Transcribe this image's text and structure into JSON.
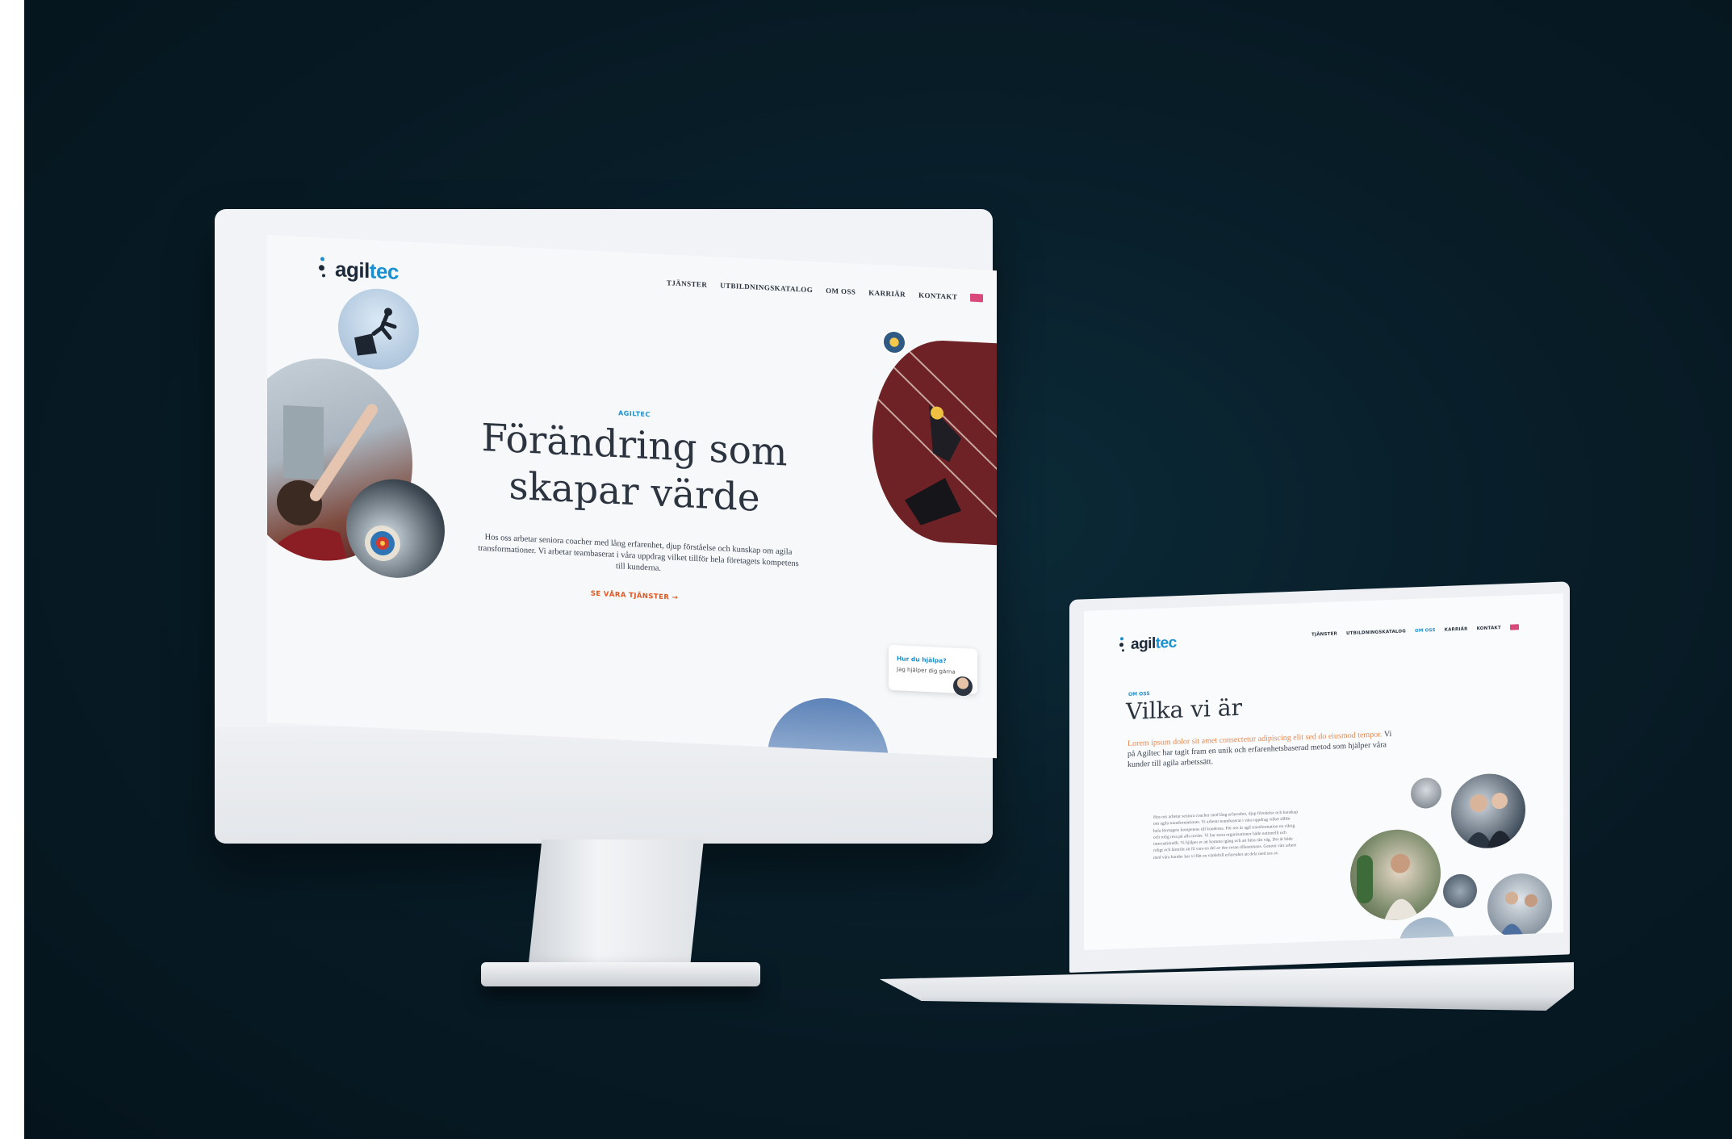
{
  "desktop_site": {
    "logo": {
      "text_dark": "agil",
      "text_accent": "tec"
    },
    "nav": [
      "TJÄNSTER",
      "UTBILDNINGSKATALOG",
      "OM OSS",
      "KARRIÄR",
      "KONTAKT"
    ],
    "hero": {
      "eyebrow": "AGILTEC",
      "title_line1": "Förändring som",
      "title_line2": "skapar värde",
      "body": "Hos oss arbetar seniora coacher med lång erfarenhet, djup förståelse och kunskap om agila transformationer. Vi arbetar teambaserat i våra uppdrag vilket tillför hela företagets kompetens till kunderna.",
      "cta": "SE VÅRA TJÄNSTER →"
    },
    "chat": {
      "title": "Hur du hjälpa?",
      "subtitle": "Jag hjälper dig gärna"
    }
  },
  "laptop_site": {
    "logo": {
      "text_dark": "agil",
      "text_accent": "tec"
    },
    "nav": [
      "TJÄNSTER",
      "UTBILDNINGSKATALOG",
      "OM OSS",
      "KARRIÄR",
      "KONTAKT"
    ],
    "active_nav": "OM OSS",
    "eyebrow": "OM OSS",
    "title": "Vilka vi är",
    "lead_orange": "Lorem ipsum dolor sit amet consectetur adipiscing elit sed do eiusmod tempor.",
    "lead": "Vi på Agiltec har tagit fram en unik och erfarenhetsbaserad metod som hjälper våra kunder till agila arbetssätt.",
    "paragraph": "Hos oss arbetar seniora coacher med lång erfarenhet, djup förståelse och kunskap om agila transformationer. Vi arbetar teambaserat i våra uppdrag vilket tillför hela företagets kompetens till kunderna. För oss är agil transformation en viktig och rolig resa på alla nivåer. Vi har stora organisationer både nationellt och internationellt. Vi hjälper er att komma igång och att hitta rätt väg. Det är både roligt och lärorikt att få vara en del av den resan tillsammans. Genom vårt arbete med våra kunder har vi fått en värdefull erfarenhet att dela med oss av."
  },
  "colors": {
    "background": "#081d28",
    "brand_blue": "#1a90d0",
    "cta_orange": "#e1571f"
  }
}
